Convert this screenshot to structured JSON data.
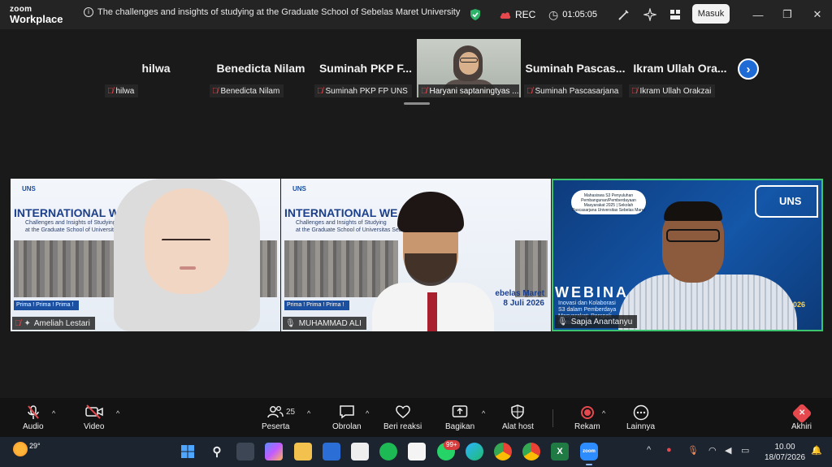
{
  "app": {
    "brand_line1": "zoom",
    "brand_line2": "Workplace"
  },
  "meeting": {
    "title": "The challenges and insights of studying at the Graduate School of Sebelas Maret University",
    "rec_label": "REC",
    "timer": "01:05:05"
  },
  "titlebar": {
    "signin_label": "Masuk"
  },
  "gallery": {
    "participants": [
      {
        "name": "hilwa",
        "tag": "hilwa"
      },
      {
        "name": "Benedicta Nilam",
        "tag": "Benedicta Nilam"
      },
      {
        "name": "Suminah  PKP  F...",
        "tag": "Suminah PKP FP UNS"
      },
      {
        "name": "",
        "tag": "Haryani saptaningtyas ..."
      },
      {
        "name": "Suminah  Pascas...",
        "tag": "Suminah Pascasarjana"
      },
      {
        "name": "Ikram  Ullah  Ora...",
        "tag": "Ikram Ullah Orakzai"
      }
    ]
  },
  "videos": [
    {
      "label": "Ameliah Lestari",
      "slide_title": "INTERNATIONAL WE",
      "slide_sub": "Challenges and Insights of Studying",
      "slide_sub2": "at the Graduate School of Universitas Seb",
      "prima": "Prima ! Prima ! Prima !"
    },
    {
      "label": "MUHAMMAD ALI",
      "slide_title": "INTERNATIONAL WE",
      "slide_sub": "Challenges and Insights of Studying",
      "slide_sub2": "at the Graduate School of Universitas Sebe",
      "prima": "Prima ! Prima ! Prima !",
      "date_line1": "ebelas Maret",
      "date_line2": "8 Juli 2026"
    },
    {
      "label": "Sapja Anantanyu",
      "webinar": "WEBINA",
      "wsub": "Inovasi dan Kolaborasi\nS3 dalam Pemberdaya\nMasyarakat: Perspek\nMultidisiplin",
      "mei": "MEI 2026",
      "uns": "UNS",
      "pill": "Mahasiswa S3 Penyuluhan Pembangunan/Pemberdayaan Masyarakat 2025 | Sekolah Pascasarjana Universitas Sebelas Maret"
    }
  ],
  "toolbar": {
    "audio": "Audio",
    "video": "Video",
    "participants": "Peserta",
    "participants_count": "25",
    "chat": "Obrolan",
    "react": "Beri reaksi",
    "share": "Bagikan",
    "host_tools": "Alat host",
    "record": "Rekam",
    "more": "Lainnya",
    "end": "Akhiri"
  },
  "taskbar": {
    "temp": "29°",
    "time": "10.00",
    "date": "18/07/2026",
    "badge": "99+"
  }
}
